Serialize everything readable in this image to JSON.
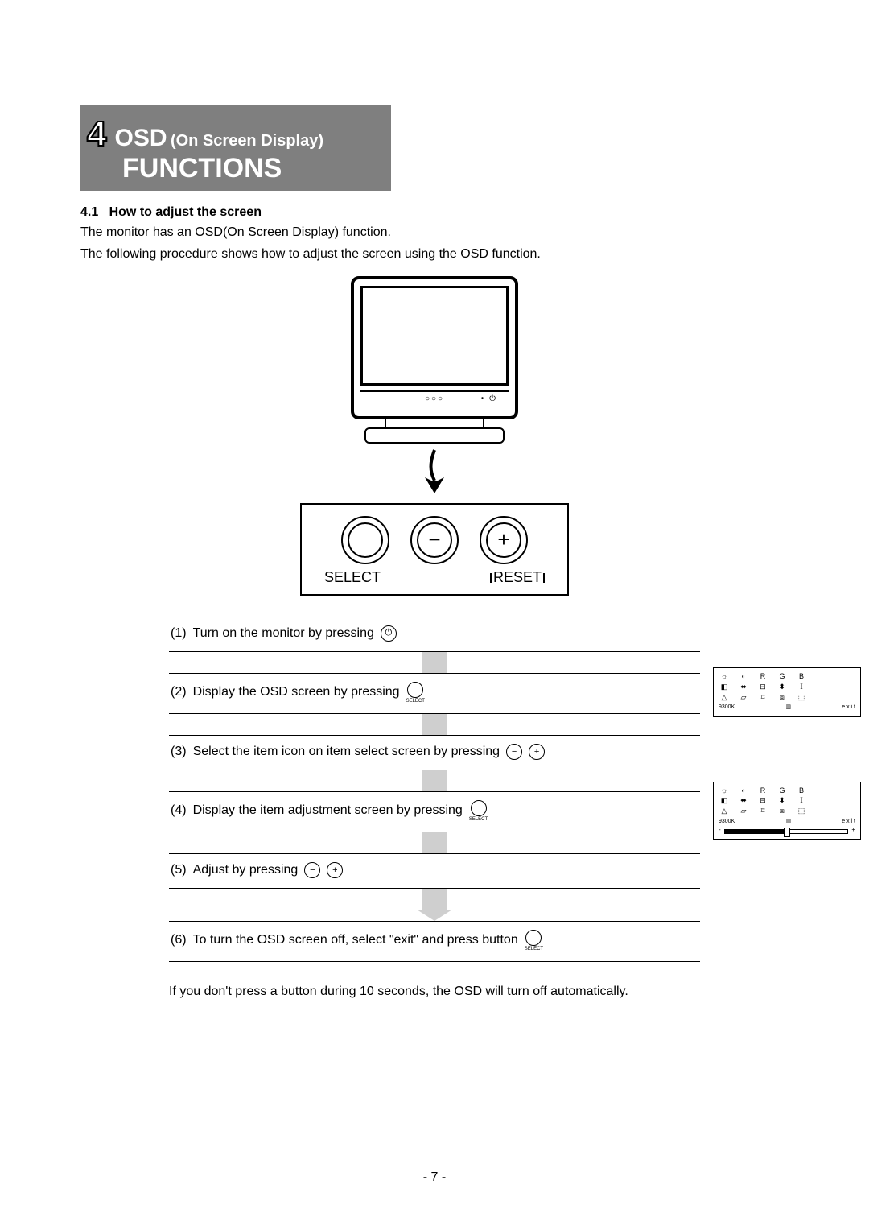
{
  "header": {
    "chapter_number": "4",
    "osd": "OSD",
    "osd_sub": "(On Screen Display)",
    "functions": "FUNCTIONS"
  },
  "section": {
    "number": "4.1",
    "title": "How to adjust the screen",
    "paragraph1": "The monitor has an OSD(On Screen Display) function.",
    "paragraph2": "The following procedure shows how to adjust the screen using the OSD function."
  },
  "panel": {
    "select": "SELECT",
    "reset": "RESET",
    "minus": "−",
    "plus": "+"
  },
  "monitor_strip": "○○○",
  "monitor_strip_btn": "• ⏻",
  "steps": [
    {
      "n": "(1)",
      "text": "Turn on the monitor by pressing",
      "icon": "power"
    },
    {
      "n": "(2)",
      "text": "Display the OSD screen by pressing",
      "icon": "select",
      "osd": "menu"
    },
    {
      "n": "(3)",
      "text": "Select the item icon on item select screen by pressing",
      "icon": "plusminus"
    },
    {
      "n": "(4)",
      "text": "Display the item adjustment screen by pressing",
      "icon": "select",
      "osd": "slider"
    },
    {
      "n": "(5)",
      "text": "Adjust by pressing",
      "icon": "plusminus"
    },
    {
      "n": "(6)",
      "text": "To turn the OSD screen off, select \"exit\" and press button",
      "icon": "select"
    }
  ],
  "osd_menu": {
    "row1": [
      "☼",
      "◐",
      "R",
      "G",
      "B"
    ],
    "row2": [
      "◧",
      "⬌",
      "⊟",
      "⬍",
      "𝕀"
    ],
    "row3": [
      "△",
      "▱",
      "⌑",
      "⧈",
      "⬚"
    ],
    "bottom_left": "9300K",
    "bottom_mid": "▥",
    "bottom_right": "e x i t"
  },
  "slider_labels": {
    "left": "-",
    "right": "+"
  },
  "note": "If you don't press a button during 10 seconds, the OSD will turn off automatically.",
  "select_small": "SELECT",
  "page_number": "- 7 -"
}
